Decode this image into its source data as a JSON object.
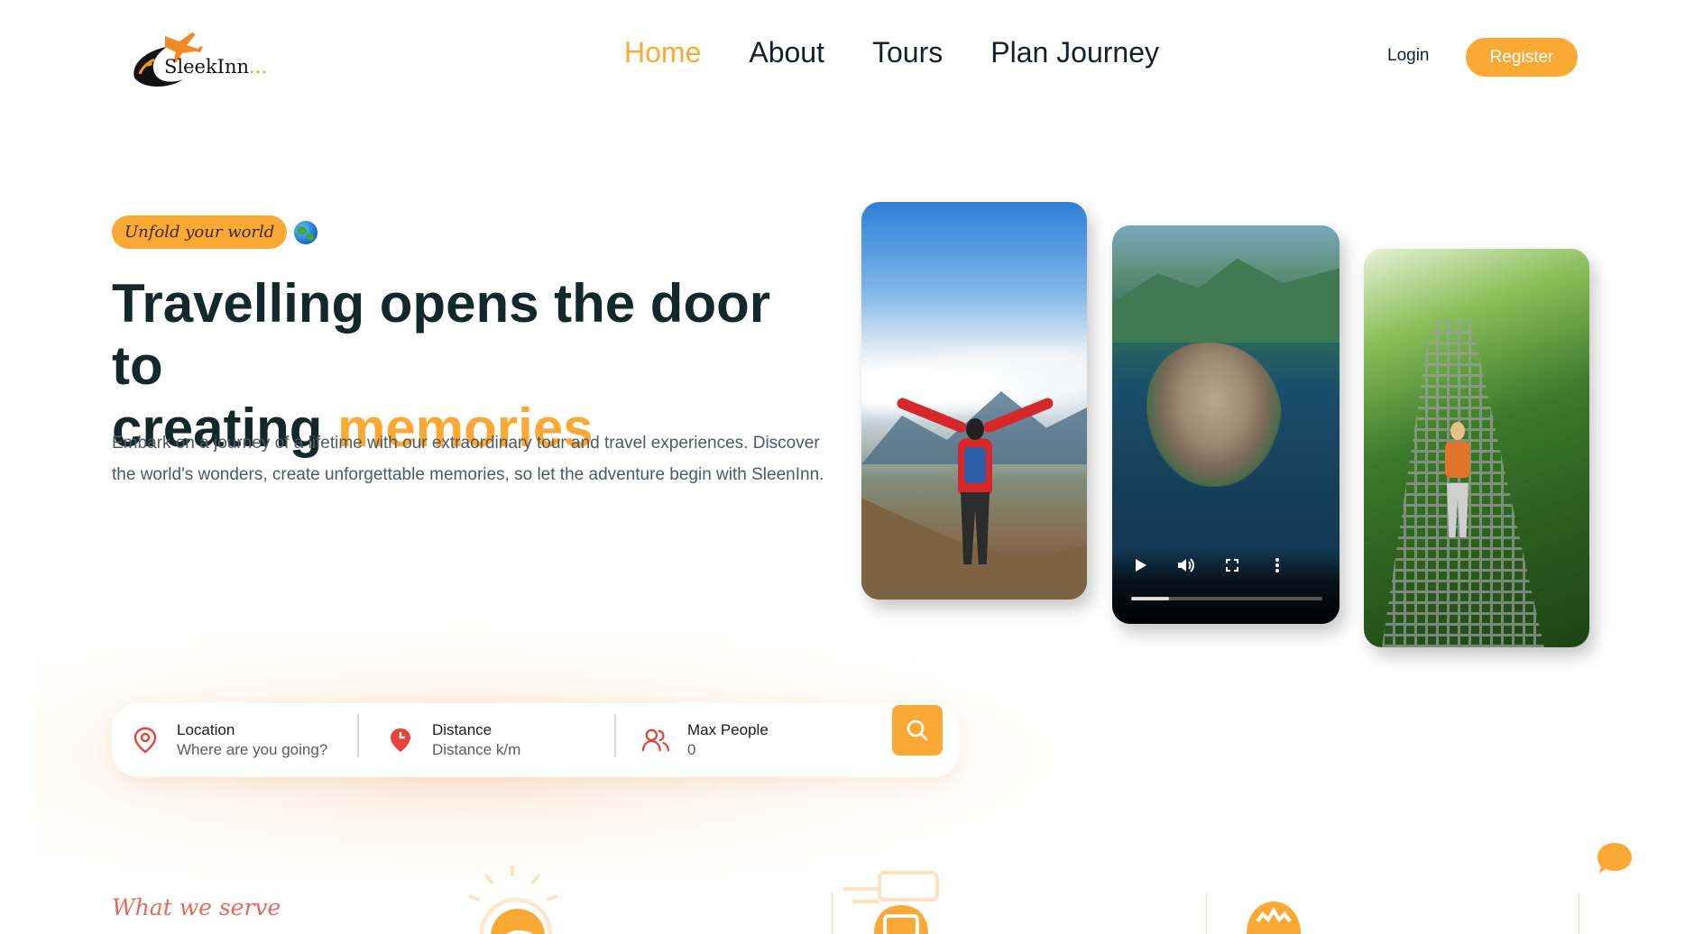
{
  "brand": {
    "name": "SleekInn",
    "name_suffix": "..."
  },
  "nav": {
    "items": [
      {
        "label": "Home",
        "active": true
      },
      {
        "label": "About",
        "active": false
      },
      {
        "label": "Tours",
        "active": false
      },
      {
        "label": "Plan Journey",
        "active": false
      }
    ],
    "login_label": "Login",
    "register_label": "Register"
  },
  "hero": {
    "badge": "Unfold your world",
    "headline_line1": "Travelling opens the door to",
    "headline_line2_prefix": "creating ",
    "headline_accent": "memories",
    "lead": "Embark on a journey of a lifetime with our extraordinary tour and travel experiences. Discover the world's wonders, create unforgettable memories, so let the adventure begin with SleenInn."
  },
  "video": {
    "progress": 0.2,
    "controls": [
      "play-icon",
      "volume-icon",
      "fullscreen-icon",
      "more-options-icon"
    ]
  },
  "search": {
    "location": {
      "label": "Location",
      "placeholder": "Where are you going?"
    },
    "distance": {
      "label": "Distance",
      "placeholder": "Distance k/m"
    },
    "people": {
      "label": "Max People",
      "placeholder": "0"
    },
    "button_icon": "search-icon"
  },
  "serve": {
    "title": "What we serve"
  },
  "colors": {
    "accent": "#faa935",
    "heading": "#12282a",
    "serve_title": "#e66a5c",
    "icon_red": "#e8423a"
  }
}
